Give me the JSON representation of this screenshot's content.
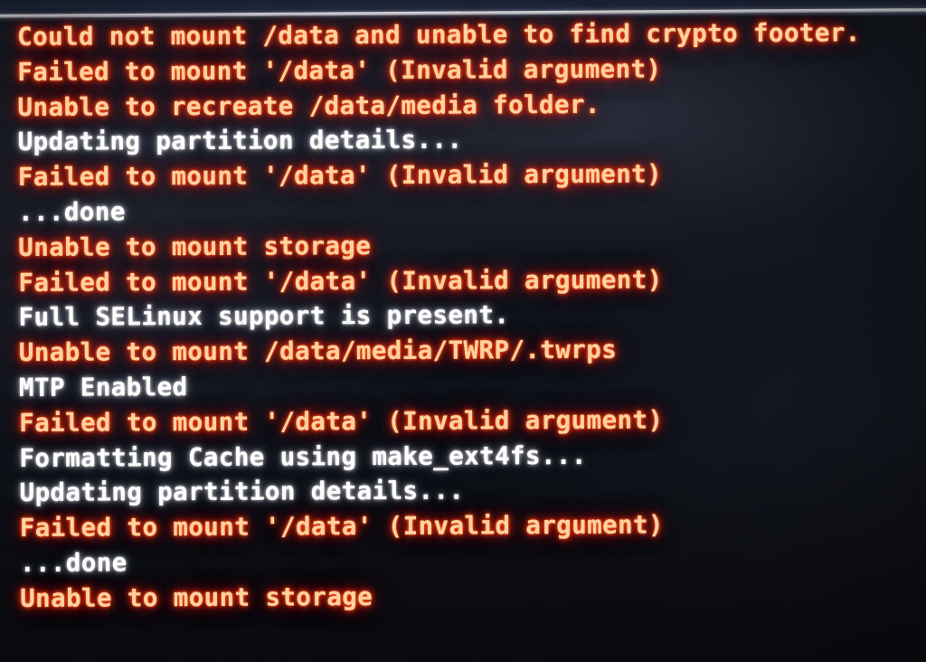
{
  "screen": {
    "device_context": "TWRP recovery console output",
    "bezel_color": "#232b40",
    "separator_color": "#f2f4f8",
    "background_color": "#0d1018",
    "error_text_color": "#ff3b14",
    "info_text_color": "#fdfdfd"
  },
  "console": {
    "lines": [
      {
        "text": "Could not mount /data and unable to find crypto footer.",
        "type": "err"
      },
      {
        "text": "Failed to mount '/data' (Invalid argument)",
        "type": "err"
      },
      {
        "text": "Unable to recreate /data/media folder.",
        "type": "err"
      },
      {
        "text": "Updating partition details...",
        "type": "info"
      },
      {
        "text": "Failed to mount '/data' (Invalid argument)",
        "type": "err"
      },
      {
        "text": "...done",
        "type": "info"
      },
      {
        "text": "Unable to mount storage",
        "type": "err"
      },
      {
        "text": "Failed to mount '/data' (Invalid argument)",
        "type": "err"
      },
      {
        "text": "Full SELinux support is present.",
        "type": "info"
      },
      {
        "text": "Unable to mount /data/media/TWRP/.twrps",
        "type": "err"
      },
      {
        "text": "MTP Enabled",
        "type": "info"
      },
      {
        "text": "Failed to mount '/data' (Invalid argument)",
        "type": "err"
      },
      {
        "text": "Formatting Cache using make_ext4fs...",
        "type": "info"
      },
      {
        "text": "Updating partition details...",
        "type": "info"
      },
      {
        "text": "Failed to mount '/data' (Invalid argument)",
        "type": "err"
      },
      {
        "text": "...done",
        "type": "info"
      },
      {
        "text": "Unable to mount storage",
        "type": "err"
      }
    ]
  }
}
